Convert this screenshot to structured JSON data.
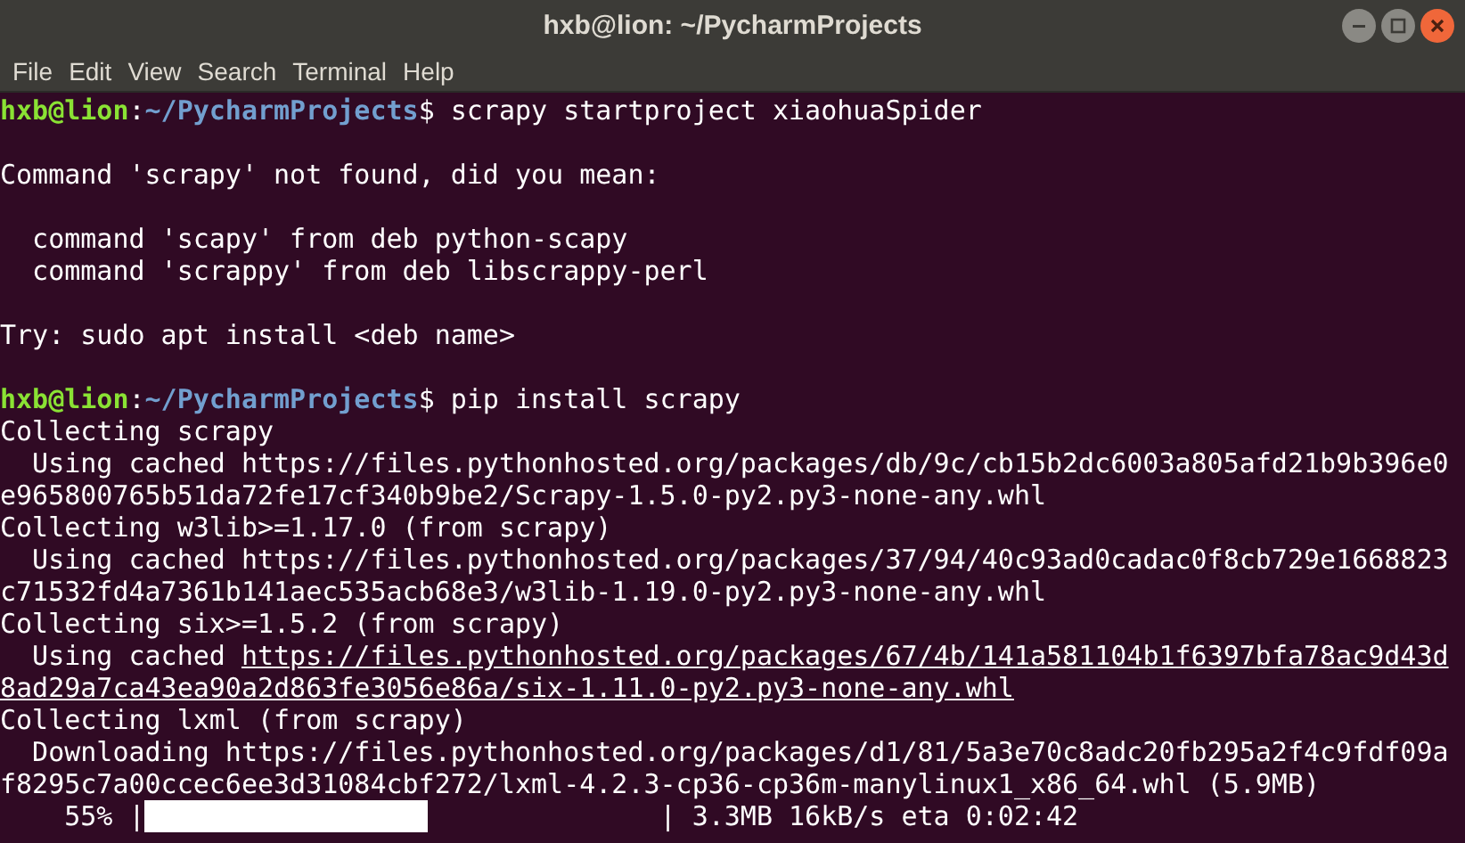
{
  "window": {
    "title": "hxb@lion: ~/PycharmProjects"
  },
  "menu": [
    "File",
    "Edit",
    "View",
    "Search",
    "Terminal",
    "Help"
  ],
  "terminal": {
    "lines": [
      {
        "kind": "prompt",
        "user": "hxb@lion",
        "sep": ":",
        "path": "~/PycharmProjects",
        "symbol": "$",
        "command": " scrapy startproject xiaohuaSpider"
      },
      {
        "kind": "blank"
      },
      {
        "kind": "output",
        "text": "Command 'scrapy' not found, did you mean:"
      },
      {
        "kind": "blank"
      },
      {
        "kind": "output",
        "text": "  command 'scapy' from deb python-scapy"
      },
      {
        "kind": "output",
        "text": "  command 'scrappy' from deb libscrappy-perl"
      },
      {
        "kind": "blank"
      },
      {
        "kind": "output",
        "text": "Try: sudo apt install <deb name>"
      },
      {
        "kind": "blank"
      },
      {
        "kind": "prompt",
        "user": "hxb@lion",
        "sep": ":",
        "path": "~/PycharmProjects",
        "symbol": "$",
        "command": " pip install scrapy"
      },
      {
        "kind": "output",
        "text": "Collecting scrapy"
      },
      {
        "kind": "output",
        "text": "  Using cached https://files.pythonhosted.org/packages/db/9c/cb15b2dc6003a805afd21b9b396e0"
      },
      {
        "kind": "output",
        "text": "e965800765b51da72fe17cf340b9be2/Scrapy-1.5.0-py2.py3-none-any.whl"
      },
      {
        "kind": "output",
        "text": "Collecting w3lib>=1.17.0 (from scrapy)"
      },
      {
        "kind": "output",
        "text": "  Using cached https://files.pythonhosted.org/packages/37/94/40c93ad0cadac0f8cb729e1668823"
      },
      {
        "kind": "output",
        "text": "c71532fd4a7361b141aec535acb68e3/w3lib-1.19.0-py2.py3-none-any.whl"
      },
      {
        "kind": "output",
        "text": "Collecting six>=1.5.2 (from scrapy)"
      },
      {
        "kind": "output",
        "text": "  Using cached ",
        "link": "https://files.pythonhosted.org/packages/67/4b/141a581104b1f6397bfa78ac9d43d"
      },
      {
        "kind": "output",
        "link": "8ad29a7ca43ea90a2d863fe3056e86a/six-1.11.0-py2.py3-none-any.whl"
      },
      {
        "kind": "output",
        "text": "Collecting lxml (from scrapy)"
      },
      {
        "kind": "output",
        "text": "  Downloading https://files.pythonhosted.org/packages/d1/81/5a3e70c8adc20fb295a2f4c9fdf09a"
      },
      {
        "kind": "output",
        "text": "f8295c7a00ccec6ee3d31084cbf272/lxml-4.2.3-cp36-cp36m-manylinux1_x86_64.whl (5.9MB)"
      },
      {
        "kind": "progress",
        "percent": "    55%",
        "open": " |",
        "level": 0.55,
        "close": "|",
        "stats": " 3.3MB 16kB/s eta 0:02:42"
      }
    ]
  }
}
